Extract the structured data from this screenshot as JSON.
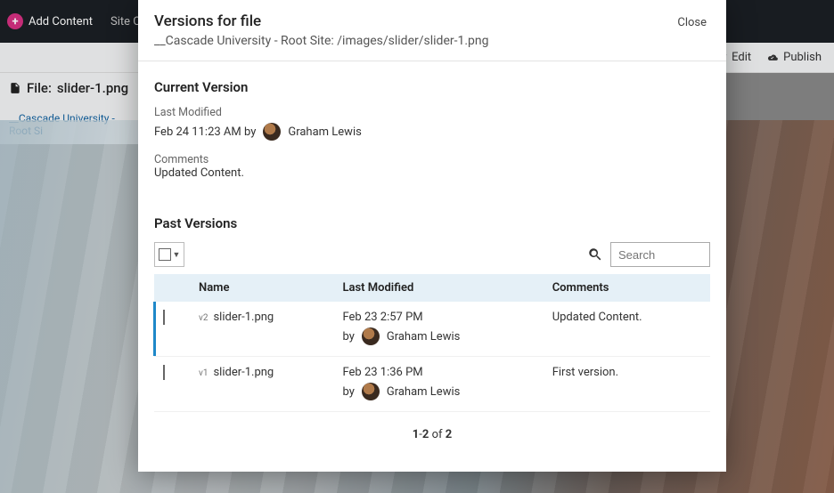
{
  "topbar": {
    "add_label": "Add Content",
    "site_content_label": "Site Content"
  },
  "subbar": {
    "edit_label": "Edit",
    "publish_label": "Publish"
  },
  "filepane": {
    "prefix": "File:",
    "filename": "slider-1.png",
    "crumb": "__Cascade University - Root Si"
  },
  "modal": {
    "title": "Versions for file",
    "path": "__Cascade University - Root Site: /images/slider/slider-1.png",
    "close": "Close"
  },
  "current": {
    "heading": "Current Version",
    "last_modified_label": "Last Modified",
    "timestamp": "Feb 24 11:23 AM by",
    "author": "Graham Lewis",
    "comments_label": "Comments",
    "comments_text": "Updated Content."
  },
  "past": {
    "heading": "Past Versions",
    "search_placeholder": "Search",
    "columns": {
      "name": "Name",
      "last_modified": "Last Modified",
      "comments": "Comments"
    },
    "rows": [
      {
        "vtag": "v2",
        "name": "slider-1.png",
        "date": "Feb 23 2:57 PM",
        "by_prefix": "by",
        "author": "Graham Lewis",
        "comments": "Updated Content."
      },
      {
        "vtag": "v1",
        "name": "slider-1.png",
        "date": "Feb 23 1:36 PM",
        "by_prefix": "by",
        "author": "Graham Lewis",
        "comments": "First version."
      }
    ],
    "pager": {
      "start": "1",
      "end": "2",
      "of_label": "of",
      "total": "2"
    }
  }
}
